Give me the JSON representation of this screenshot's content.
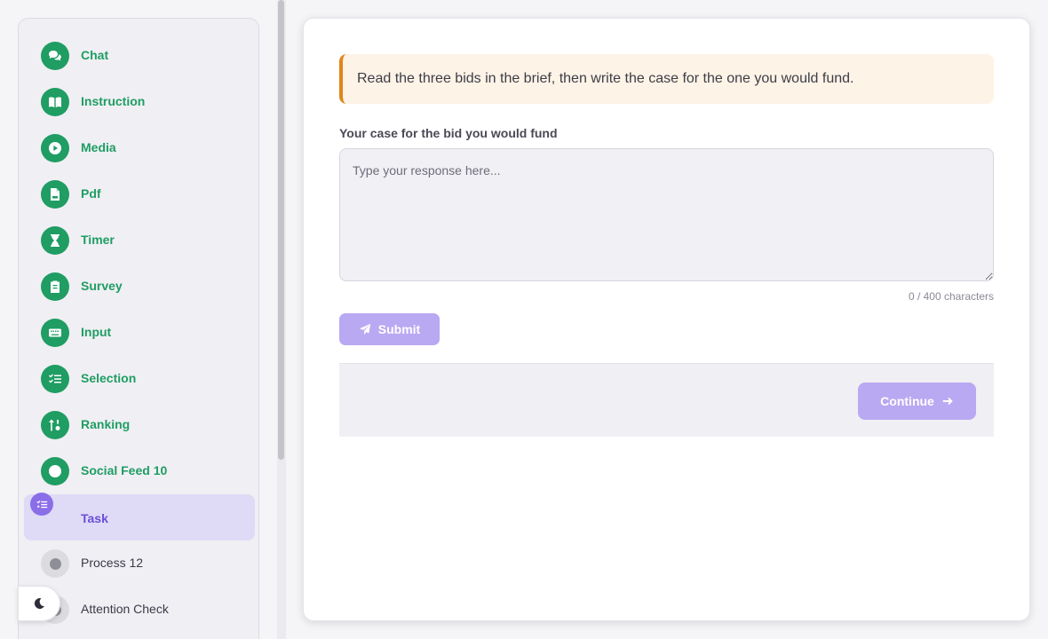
{
  "sidebar": {
    "items": [
      {
        "label": "Chat",
        "icon": "chat-icon",
        "state": "done"
      },
      {
        "label": "Instruction",
        "icon": "book-icon",
        "state": "done"
      },
      {
        "label": "Media",
        "icon": "play-icon",
        "state": "done"
      },
      {
        "label": "Pdf",
        "icon": "pdf-file-icon",
        "state": "done"
      },
      {
        "label": "Timer",
        "icon": "hourglass-icon",
        "state": "done"
      },
      {
        "label": "Survey",
        "icon": "clipboard-icon",
        "state": "done"
      },
      {
        "label": "Input",
        "icon": "keyboard-icon",
        "state": "done"
      },
      {
        "label": "Selection",
        "icon": "checklist-icon",
        "state": "done"
      },
      {
        "label": "Ranking",
        "icon": "sort-icon",
        "state": "done"
      },
      {
        "label": "Social Feed 10",
        "icon": "circle-icon",
        "state": "done"
      },
      {
        "label": "Task",
        "icon": "task-list-icon",
        "state": "active"
      },
      {
        "label": "Process 12",
        "icon": "pending-dot-icon",
        "state": "pending"
      },
      {
        "label": "Attention Check",
        "icon": "pending-dot-icon",
        "state": "pending"
      }
    ]
  },
  "theme_toggle": {
    "icon": "moon-icon"
  },
  "main": {
    "brief_text": "Read the three bids in the brief, then write the case for the one you would fund.",
    "field_label": "Your case for the bid you would fund",
    "response_placeholder": "Type your response here...",
    "response_value": "",
    "counter": "0 / 400 characters",
    "submit_label": "Submit",
    "submit_icon": "send-icon",
    "continue_label": "Continue",
    "continue_icon": "arrow-right-icon"
  },
  "colors": {
    "completed": "#1f9d63",
    "active": "#8a6ee8",
    "button": "#b9a8f2",
    "brief_accent": "#e0861a"
  }
}
